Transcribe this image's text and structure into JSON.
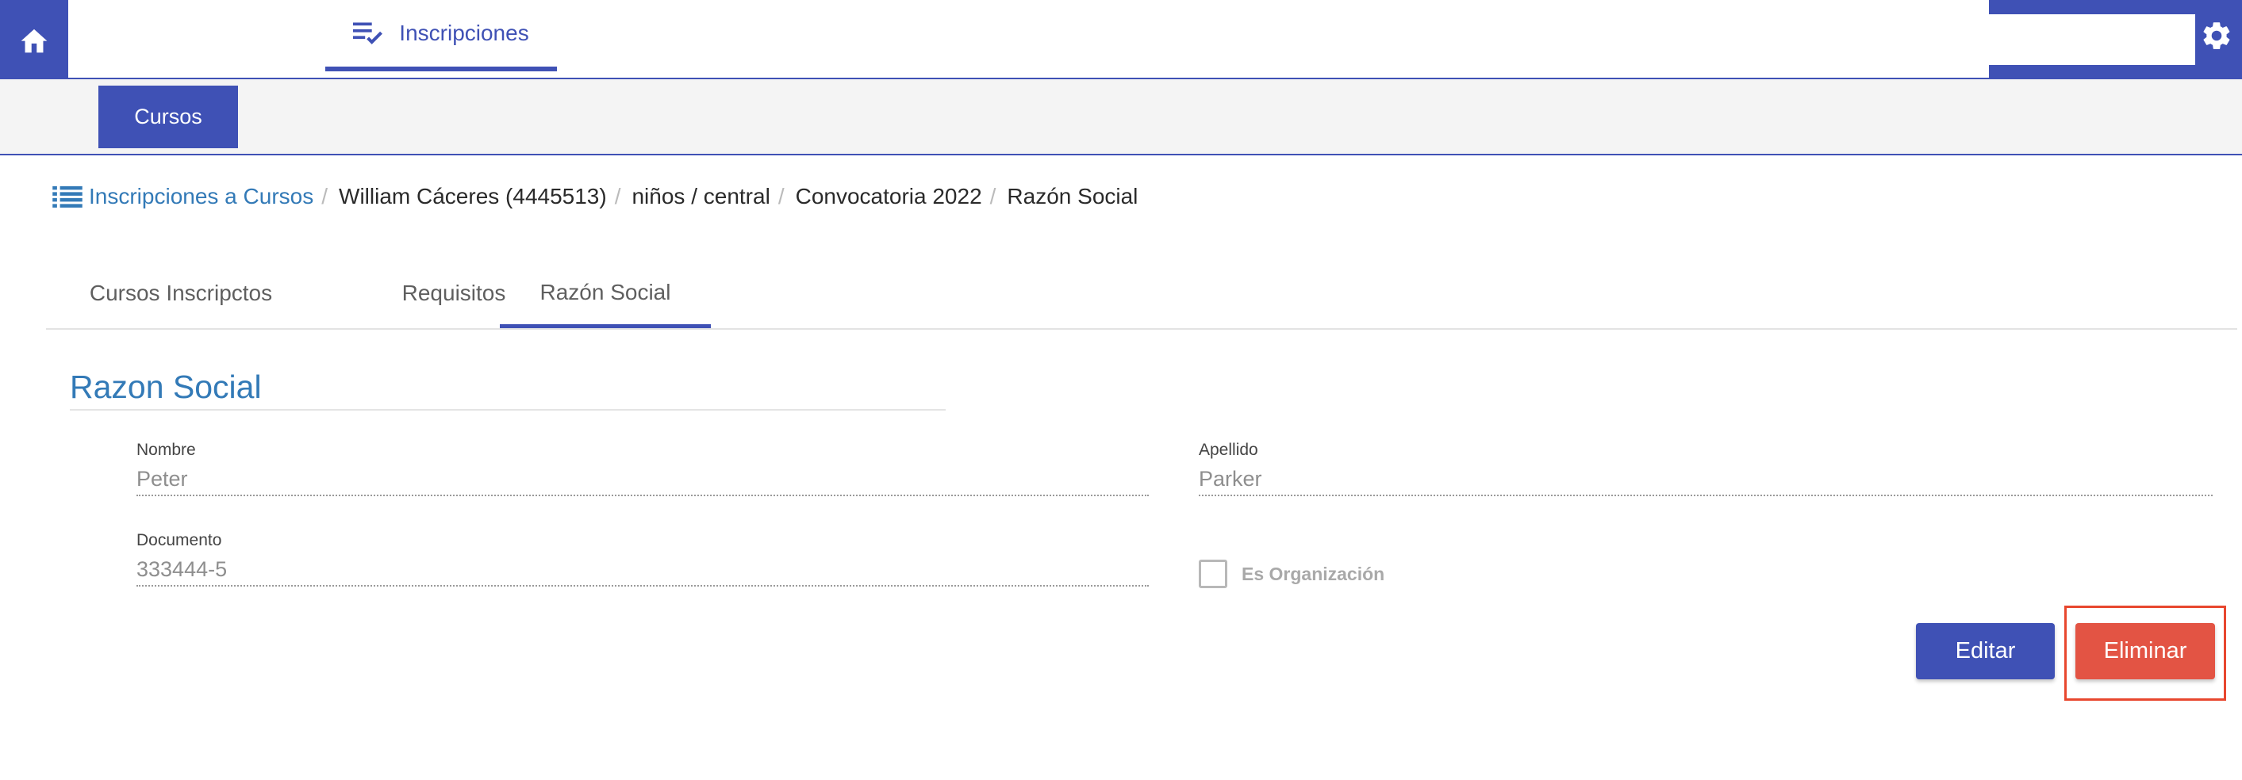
{
  "header": {
    "nav_tab_label": "Inscripciones",
    "icons": {
      "home": "home-icon",
      "nav_tab": "playlist-check-icon",
      "settings": "gear-icon"
    },
    "accent_color": "#3f51b5"
  },
  "subnav": {
    "cursos_label": "Cursos"
  },
  "breadcrumb": {
    "icon": "list-icon",
    "link": "Inscripciones a Cursos",
    "separator": "/",
    "items": [
      "William Cáceres (4445513)",
      "niños / central",
      "Convocatoria 2022",
      "Razón Social"
    ]
  },
  "tabs": [
    {
      "label": "Cursos Inscripctos",
      "active": false
    },
    {
      "label": "Requisitos",
      "active": false
    },
    {
      "label": "Razón Social",
      "active": true
    }
  ],
  "section": {
    "title": "Razon Social",
    "fields": {
      "nombre": {
        "label": "Nombre",
        "value": "Peter"
      },
      "apellido": {
        "label": "Apellido",
        "value": "Parker"
      },
      "documento": {
        "label": "Documento",
        "value": "333444-5"
      }
    },
    "checkbox": {
      "label": "Es Organización",
      "checked": false
    }
  },
  "actions": {
    "edit_label": "Editar",
    "delete_label": "Eliminar",
    "delete_color": "#e35444"
  }
}
